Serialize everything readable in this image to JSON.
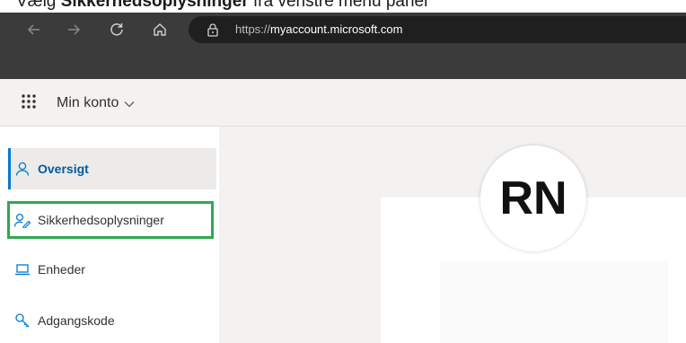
{
  "instruction": {
    "prefix": "Vælg ",
    "bold": "Sikkerhedsoplysninger",
    "suffix": " fra venstre menu panel"
  },
  "browser": {
    "url_scheme": "https://",
    "url_host": "myaccount.microsoft.com",
    "nav_icons": [
      "back-icon",
      "forward-icon",
      "refresh-icon",
      "home-icon",
      "lock-icon"
    ]
  },
  "appbar": {
    "title": "Min konto"
  },
  "sidebar": {
    "items": [
      {
        "label": "Oversigt",
        "icon": "person-icon",
        "active": true
      },
      {
        "label": "Sikkerhedsoplysninger",
        "icon": "security-info-icon",
        "highlighted": true
      },
      {
        "label": "Enheder",
        "icon": "laptop-icon"
      },
      {
        "label": "Adgangskode",
        "icon": "key-icon"
      }
    ]
  },
  "profile": {
    "initials": "RN"
  },
  "colors": {
    "accent": "#0078d4",
    "highlight_box": "#2fa84f",
    "browser_chrome": "#3b3b3b"
  }
}
